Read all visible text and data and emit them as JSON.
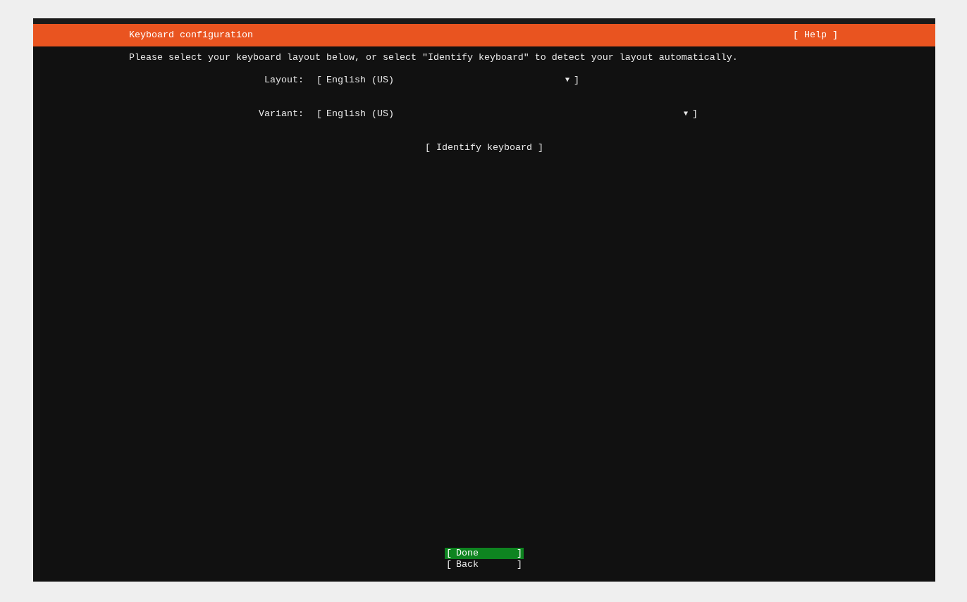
{
  "header": {
    "title": "Keyboard configuration",
    "help": "[ Help ]"
  },
  "intro": "Please select your keyboard layout below, or select \"Identify keyboard\" to detect your layout automatically.",
  "fields": [
    {
      "label": "Layout:",
      "open": "[",
      "value": "English (US)",
      "arrow": "▼",
      "close": "]"
    },
    {
      "label": "Variant:",
      "open": "[",
      "value": "English (US)",
      "arrow": "▼",
      "close": "]"
    }
  ],
  "identify": "[ Identify keyboard ]",
  "buttons": [
    {
      "open": "[",
      "label": "Done",
      "close": "]",
      "selected": true
    },
    {
      "open": "[",
      "label": "Back",
      "close": "]",
      "selected": false
    }
  ]
}
